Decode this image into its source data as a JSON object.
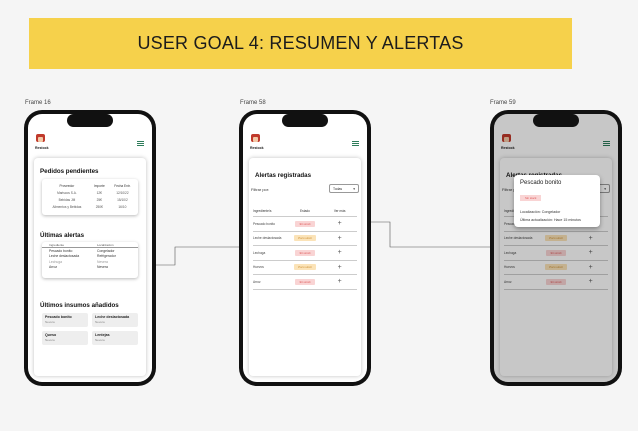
{
  "banner": {
    "title": "USER GOAL 4: RESUMEN Y ALERTAS"
  },
  "frames": {
    "f1": "Frame 16",
    "f2": "Frame 58",
    "f3": "Frame 59"
  },
  "app": {
    "logo_text": "Restock"
  },
  "home": {
    "pedidos_title": "Pedidos pendientes",
    "pedidos_headers": [
      "Proveedor",
      "Importe",
      "Fecha Entr."
    ],
    "pedidos_rows": [
      [
        "Mariscos S.A.",
        "12€",
        "12/10/22"
      ],
      [
        "Bebidas JM",
        "25€",
        "15/10/2"
      ],
      [
        "Alimentos y Bebidas",
        "250€",
        "16/10"
      ]
    ],
    "alertas_title": "Últimas alertas",
    "alertas_headers": [
      "Ingrediente",
      "Localización"
    ],
    "alertas_rows": [
      [
        "Pescado bonito",
        "Congelador"
      ],
      [
        "Leche deslactosada",
        "Refrigerador"
      ],
      [
        "Lechuga",
        "Nevera"
      ],
      [
        "Arroz",
        "Nevera"
      ]
    ],
    "insumos_title": "Últimos insumos añadidos",
    "insumos": [
      {
        "name": "Pescado bonito",
        "loc": "Nevera"
      },
      {
        "name": "Leche deslactosada",
        "loc": "Nevera"
      },
      {
        "name": "Queso",
        "loc": "Nevera"
      },
      {
        "name": "Lentejas",
        "loc": "Nevera"
      }
    ]
  },
  "alerts": {
    "title": "Alertas registradas",
    "filter_label": "Filtrar por:",
    "filter_value": "Todas",
    "headers": [
      "Ingrediente/s",
      "Estado",
      "Ver más"
    ],
    "rows": [
      {
        "name": "Pescado bonito",
        "status": "Sin stock",
        "tone": "red"
      },
      {
        "name": "Leche deslactosada",
        "status": "Poco stock",
        "tone": "yel"
      },
      {
        "name": "Lechuga",
        "status": "Sin stock",
        "tone": "red"
      },
      {
        "name": "Huevos",
        "status": "Poco stock",
        "tone": "yel"
      },
      {
        "name": "Arroz",
        "status": "Sin stock",
        "tone": "red"
      }
    ],
    "plus_label": "+"
  },
  "modal": {
    "title": "Pescado bonito",
    "badge": "Sin stock",
    "location": "Localización: Congelador",
    "update": "Última actualización: Hace 15 minutos"
  },
  "colors": {
    "banner": "#f6d14b",
    "danger_bg": "#f9d4d4",
    "warn_bg": "#fbe3b8",
    "accent": "#2e7d5b"
  }
}
